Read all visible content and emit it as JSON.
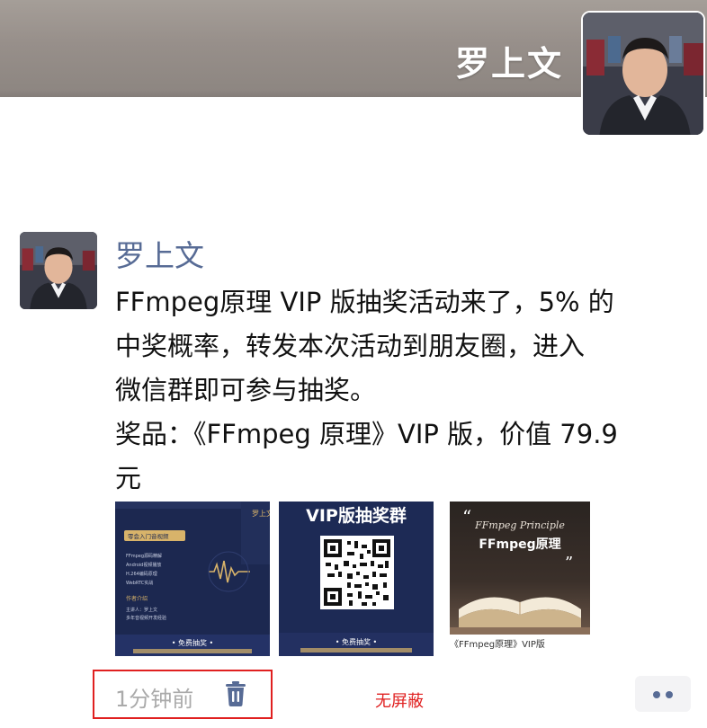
{
  "cover": {
    "name": "罗上文"
  },
  "post": {
    "author": "罗上文",
    "text_lines": [
      "FFmpeg原理 VIP 版抽奖活动来了，5% 的",
      "中奖概率，转发本次活动到朋友圈，进入",
      "微信群即可参与抽奖。",
      "奖品：《FFmpeg 原理》VIP 版，价值 79.9",
      "元"
    ],
    "images": [
      {
        "brand": "罗上文",
        "tag": "零会入门音视频",
        "bullets": [
          "FFmpeg源码精解",
          "Android视频播放",
          "H.264编码原理",
          "WebRTC实战"
        ],
        "section": "作者介绍",
        "bio": [
          "主讲人：罗上文",
          "多年音视频开发经验"
        ],
        "footer": "• 免费抽奖 •"
      },
      {
        "title": "VIP版抽奖群",
        "footer": "• 免费抽奖 •"
      },
      {
        "script_title": "FFmpeg Principle",
        "title": "FFmpeg原理",
        "caption": "《FFmpeg原理》VIP版"
      }
    ],
    "time": "1分钟前",
    "annotation": "无屏蔽"
  },
  "colors": {
    "name_blue": "#576b95",
    "annotation_red": "#e02020",
    "poster_navy": "#1d2a52",
    "gold": "#d8b36a"
  },
  "icons": {
    "delete": "trash-icon",
    "more": "more-dots-icon"
  }
}
